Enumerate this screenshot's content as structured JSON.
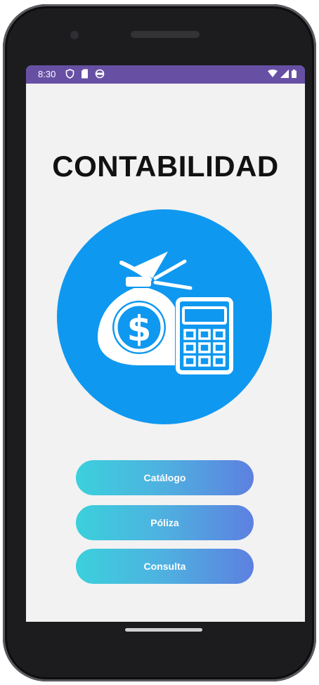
{
  "status_bar": {
    "time": "8:30",
    "left_icons": [
      "shield-icon",
      "sim-card-icon",
      "sync-icon"
    ],
    "right_icons": [
      "wifi-icon",
      "signal-icon",
      "battery-icon"
    ],
    "color": "#6750a4"
  },
  "main": {
    "title": "CONTABILIDAD",
    "logo_icon": "money-bag-calculator-icon",
    "logo_color": "#0f98f0"
  },
  "buttons": {
    "catalogo": "Catálogo",
    "poliza": "Póliza",
    "consulta": "Consulta"
  },
  "colors": {
    "button_gradient_start": "#3bd0dc",
    "button_gradient_end": "#5d80e0",
    "screen_background": "#f2f2f2"
  }
}
